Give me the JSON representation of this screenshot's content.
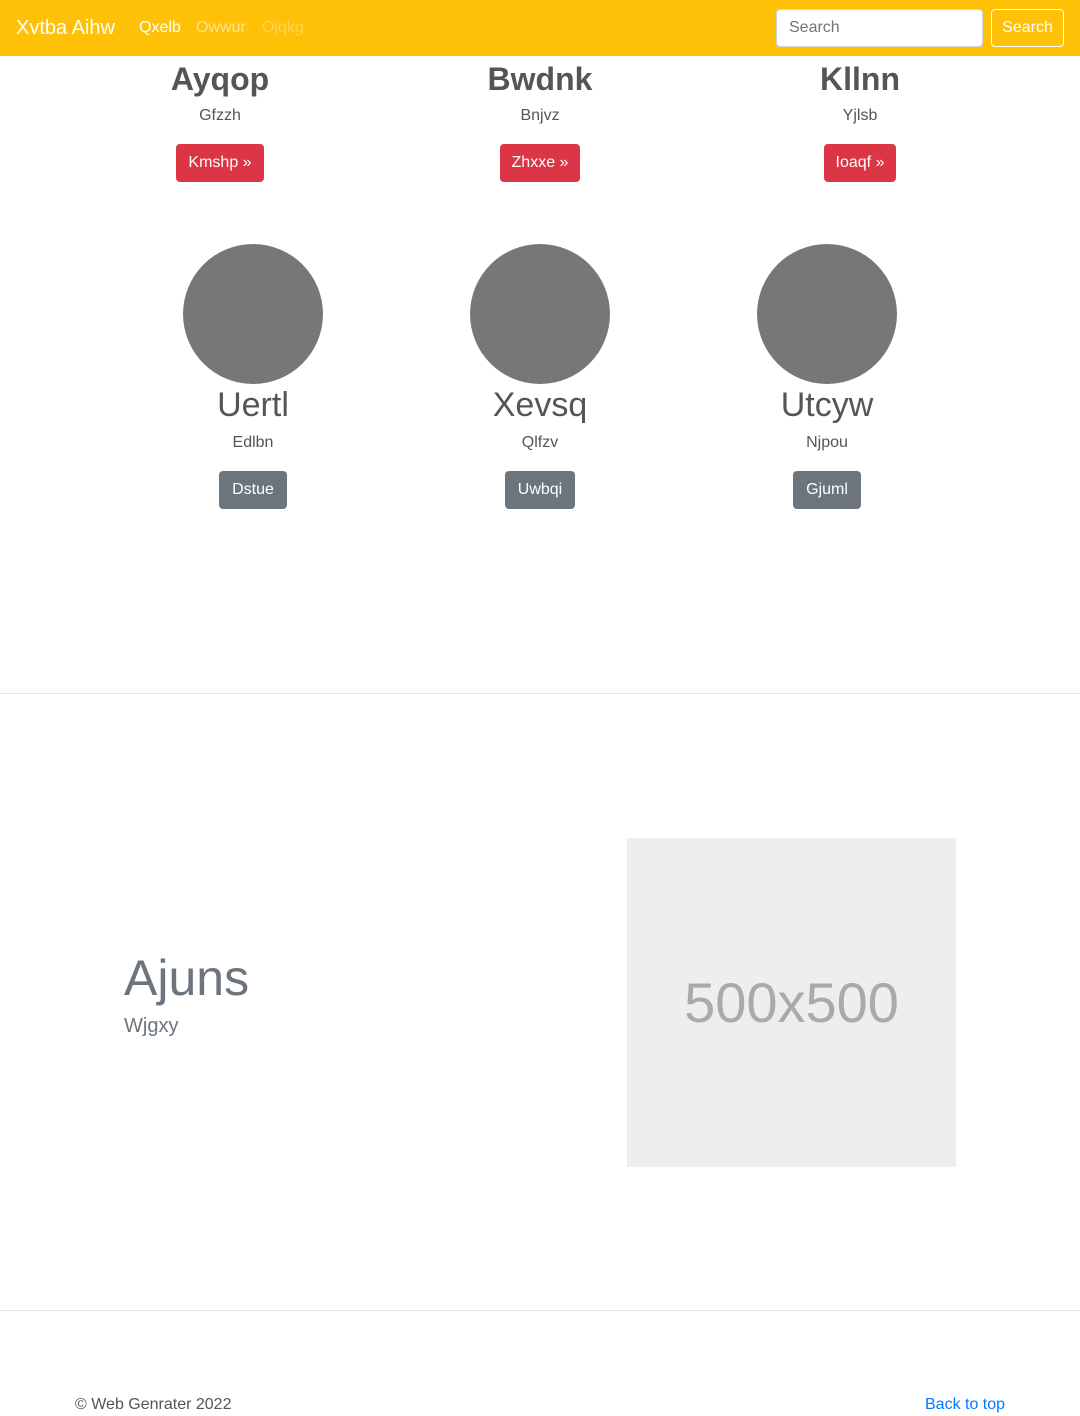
{
  "navbar": {
    "brand": "Xvtba Aihw",
    "links": [
      "Qxelb",
      "Owwur",
      "Ojqkg"
    ],
    "search": {
      "placeholder": "Search",
      "button_label": "Search"
    }
  },
  "row1": [
    {
      "title": "Ayqop",
      "subtitle": "Gfzzh",
      "button": "Kmshp »"
    },
    {
      "title": "Bwdnk",
      "subtitle": "Bnjvz",
      "button": "Zhxxe »"
    },
    {
      "title": "Kllnn",
      "subtitle": "Yjlsb",
      "button": "Ioaqf »"
    }
  ],
  "row2": [
    {
      "title": "Uertl",
      "subtitle": "Edlbn",
      "button": "Dstue"
    },
    {
      "title": "Xevsq",
      "subtitle": "Qlfzv",
      "button": "Uwbqi"
    },
    {
      "title": "Utcyw",
      "subtitle": "Njpou",
      "button": "Gjuml"
    }
  ],
  "feature": {
    "title": "Ajuns",
    "subtitle": "Wjgxy",
    "image_label": "500x500"
  },
  "footer": {
    "copyright": "© Web Genrater 2022",
    "back_to_top": "Back to top"
  },
  "colors": {
    "navbar": "#ffc107",
    "danger": "#dc3545",
    "secondary": "#6c757d",
    "link": "#007bff"
  }
}
